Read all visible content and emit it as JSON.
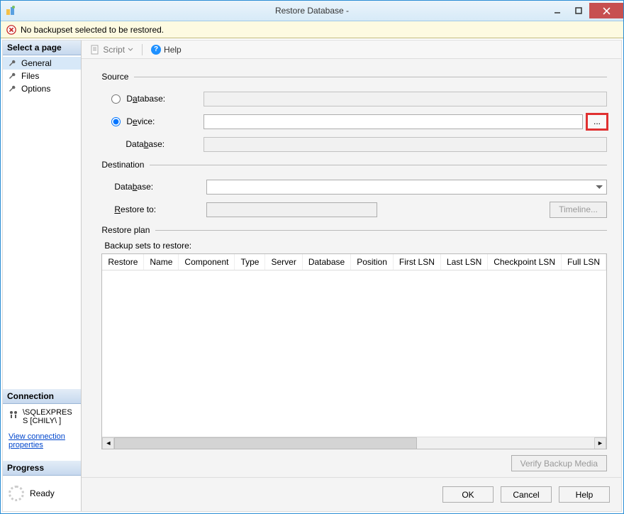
{
  "title": "Restore Database -",
  "notice": "No backupset selected to be restored.",
  "sidebar": {
    "select_page": "Select a page",
    "pages": [
      "General",
      "Files",
      "Options"
    ],
    "connection_header": "Connection",
    "connection_text": "\\SQLEXPRESS [CHILY\\        ]",
    "view_conn_props": "View connection properties",
    "progress_header": "Progress",
    "progress_status": "Ready"
  },
  "toolbar": {
    "script": "Script",
    "help": "Help"
  },
  "groups": {
    "source": "Source",
    "destination": "Destination",
    "restore_plan": "Restore plan"
  },
  "source": {
    "database_radio": "Database:",
    "device_radio": "Device:",
    "database_label": "Database:",
    "browse": "..."
  },
  "destination": {
    "database_label": "Database:",
    "restore_to_label": "Restore to:",
    "timeline_btn": "Timeline..."
  },
  "restore_plan": {
    "backup_sets_label": "Backup sets to restore:",
    "columns": [
      "Restore",
      "Name",
      "Component",
      "Type",
      "Server",
      "Database",
      "Position",
      "First LSN",
      "Last LSN",
      "Checkpoint LSN",
      "Full LSN"
    ]
  },
  "verify_btn": "Verify Backup Media",
  "footer": {
    "ok": "OK",
    "cancel": "Cancel",
    "help": "Help"
  }
}
